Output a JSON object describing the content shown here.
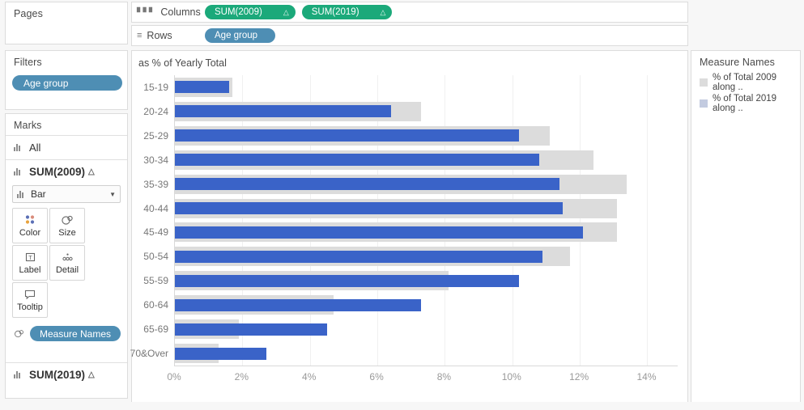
{
  "pages": {
    "title": "Pages"
  },
  "filters": {
    "title": "Filters",
    "pills": [
      {
        "label": "Age group",
        "color": "#4e8eb4"
      }
    ]
  },
  "marks": {
    "title": "Marks",
    "all_label": "All",
    "card_2009": {
      "label": "SUM(2009)",
      "delta": "△"
    },
    "mark_type": "Bar",
    "buttons": [
      {
        "label": "Color",
        "icon": "color-icon"
      },
      {
        "label": "Size",
        "icon": "size-icon"
      },
      {
        "label": "Label",
        "icon": "label-icon"
      },
      {
        "label": "Detail",
        "icon": "detail-icon"
      },
      {
        "label": "Tooltip",
        "icon": "tooltip-icon"
      }
    ],
    "measure_names_pill": "Measure Names",
    "card_2019": {
      "label": "SUM(2019)",
      "delta": "△"
    }
  },
  "shelves": {
    "columns": {
      "label": "Columns",
      "pills": [
        {
          "label": "SUM(2009)",
          "delta": "△"
        },
        {
          "label": "SUM(2019)",
          "delta": "△"
        }
      ]
    },
    "rows": {
      "label": "Rows",
      "pills": [
        {
          "label": "Age group"
        }
      ]
    }
  },
  "view": {
    "title": "as % of Yearly Total"
  },
  "legend": {
    "title": "Measure Names",
    "items": [
      {
        "label": "% of Total 2009 along ..",
        "color": "#dcdcdc"
      },
      {
        "label": "% of Total 2019 along ..",
        "color": "#c3cbe0"
      }
    ]
  },
  "chart_data": {
    "type": "bar",
    "title": "as % of Yearly Total",
    "xlabel": "",
    "ylabel": "Age group",
    "orientation": "horizontal",
    "xlim": [
      0,
      14.9
    ],
    "xticks": [
      0,
      2,
      4,
      6,
      8,
      10,
      12,
      14
    ],
    "xticklabels": [
      "0%",
      "2%",
      "4%",
      "6%",
      "8%",
      "10%",
      "12%",
      "14%"
    ],
    "grid": true,
    "legend_position": "right",
    "categories": [
      "15-19",
      "20-24",
      "25-29",
      "30-34",
      "35-39",
      "40-44",
      "45-49",
      "50-54",
      "55-59",
      "60-64",
      "65-69",
      "70&Over"
    ],
    "series": [
      {
        "name": "% of Total 2009 along ..",
        "color": "#dcdcdc",
        "values": [
          1.7,
          7.3,
          11.1,
          12.4,
          13.4,
          13.1,
          13.1,
          11.7,
          8.1,
          4.7,
          1.9,
          1.3
        ]
      },
      {
        "name": "% of Total 2019 along ..",
        "color": "#3a63c8",
        "values": [
          1.6,
          6.4,
          10.2,
          10.8,
          11.4,
          11.5,
          12.1,
          10.9,
          10.2,
          7.3,
          4.5,
          2.7
        ]
      }
    ]
  },
  "colors": {
    "measure_pill": "#1ba97a",
    "dimension_pill": "#4e8eb4",
    "bar_blue": "#3a63c8",
    "bar_grey": "#dcdcdc"
  }
}
